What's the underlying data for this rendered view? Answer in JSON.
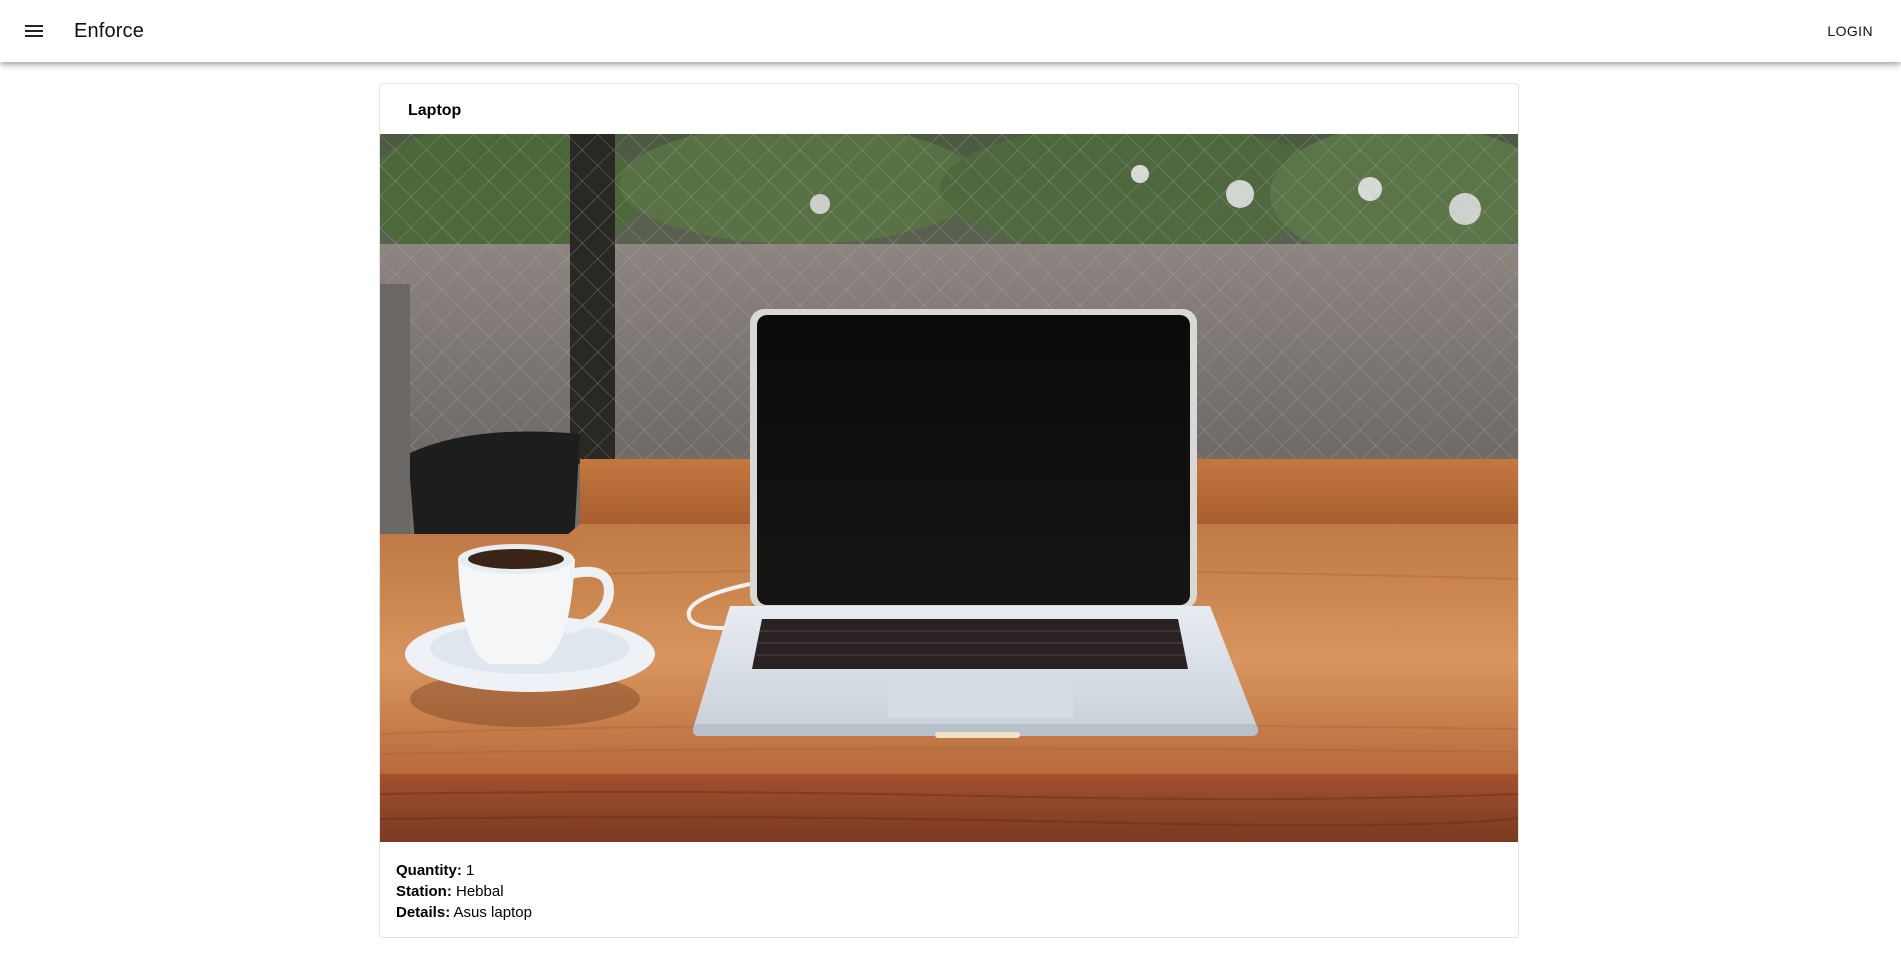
{
  "appbar": {
    "title": "Enforce",
    "menu_icon": "menu-icon",
    "login_label": "LOGIN"
  },
  "item": {
    "title": "Laptop",
    "image_alt": "laptop-photo",
    "fields": [
      {
        "label": "Quantity:",
        "value": "1"
      },
      {
        "label": "Station:",
        "value": "Hebbal"
      },
      {
        "label": "Details:",
        "value": "Asus laptop"
      }
    ]
  },
  "colors": {
    "appbar_bg": "#ffffff",
    "card_border": "#e3e3e3",
    "text": "#000000"
  }
}
